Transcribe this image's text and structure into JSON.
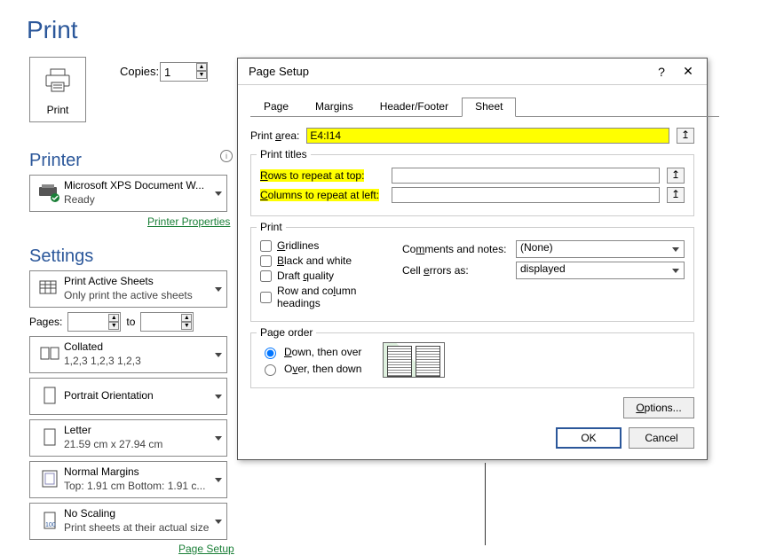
{
  "page": {
    "title": "Print"
  },
  "print_button": {
    "label": "Print"
  },
  "copies": {
    "label": "Copies:",
    "value": "1"
  },
  "printer": {
    "heading": "Printer",
    "name": "Microsoft XPS Document W...",
    "status": "Ready",
    "properties_link": "Printer Properties"
  },
  "settings": {
    "heading": "Settings",
    "pages_label": "Pages:",
    "to_label": "to",
    "page_setup_link": "Page Setup",
    "items": {
      "what": {
        "title": "Print Active Sheets",
        "sub": "Only print the active sheets"
      },
      "collate": {
        "title": "Collated",
        "sub": "1,2,3    1,2,3    1,2,3"
      },
      "orient": {
        "title": "Portrait Orientation",
        "sub": ""
      },
      "paper": {
        "title": "Letter",
        "sub": "21.59 cm x 27.94 cm"
      },
      "margins": {
        "title": "Normal Margins",
        "sub": "Top: 1.91 cm Bottom: 1.91 c..."
      },
      "scale": {
        "title": "No Scaling",
        "sub": "Print sheets at their actual size"
      }
    }
  },
  "dialog": {
    "title": "Page Setup",
    "tabs": {
      "page": "Page",
      "margins": "Margins",
      "headerfooter": "Header/Footer",
      "sheet": "Sheet"
    },
    "sheet": {
      "print_area_label": "Print area:",
      "print_area_value": "E4:I14",
      "print_titles_legend": "Print titles",
      "rows_label": "Rows to repeat at top:",
      "cols_label": "Columns to repeat at left:",
      "print_legend": "Print",
      "gridlines": "Gridlines",
      "bw": "Black and white",
      "draft": "Draft quality",
      "rowcolhead": "Row and column headings",
      "comments_label": "Comments and notes:",
      "comments_value": "(None)",
      "errors_label": "Cell errors as:",
      "errors_value": "displayed",
      "page_order_legend": "Page order",
      "down_over": "Down, then over",
      "over_down": "Over, then down",
      "options": "Options...",
      "ok": "OK",
      "cancel": "Cancel"
    }
  }
}
